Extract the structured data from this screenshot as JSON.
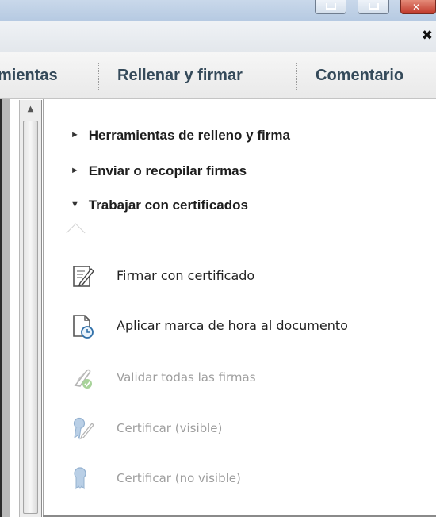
{
  "window": {
    "controls": [
      "minimize",
      "maximize",
      "close"
    ],
    "close_panel_glyph": "✖"
  },
  "tabs": [
    {
      "label": "mientas"
    },
    {
      "label": "Rellenar y firmar"
    },
    {
      "label": "Comentario"
    }
  ],
  "sections": [
    {
      "label": "Herramientas de relleno y firma",
      "state": "collapsed",
      "marker": "►"
    },
    {
      "label": "Enviar o recopilar firmas",
      "state": "collapsed",
      "marker": "►"
    },
    {
      "label": "Trabajar con certificados",
      "state": "expanded",
      "marker": "▼"
    }
  ],
  "certificate_tools": [
    {
      "label": "Firmar con certificado",
      "icon": "sign-document-icon",
      "enabled": true
    },
    {
      "label": "Aplicar marca de hora al documento",
      "icon": "timestamp-document-icon",
      "enabled": true
    },
    {
      "label": "Validar todas las firmas",
      "icon": "validate-signatures-icon",
      "enabled": false
    },
    {
      "label": "Certificar (visible)",
      "icon": "certify-visible-icon",
      "enabled": false
    },
    {
      "label": "Certificar (no visible)",
      "icon": "certify-invisible-icon",
      "enabled": false
    }
  ],
  "colors": {
    "tab_text": "#354a5a",
    "enabled_text": "#222222",
    "disabled_text": "#9e9e9e",
    "close_button": "#c0392b"
  }
}
